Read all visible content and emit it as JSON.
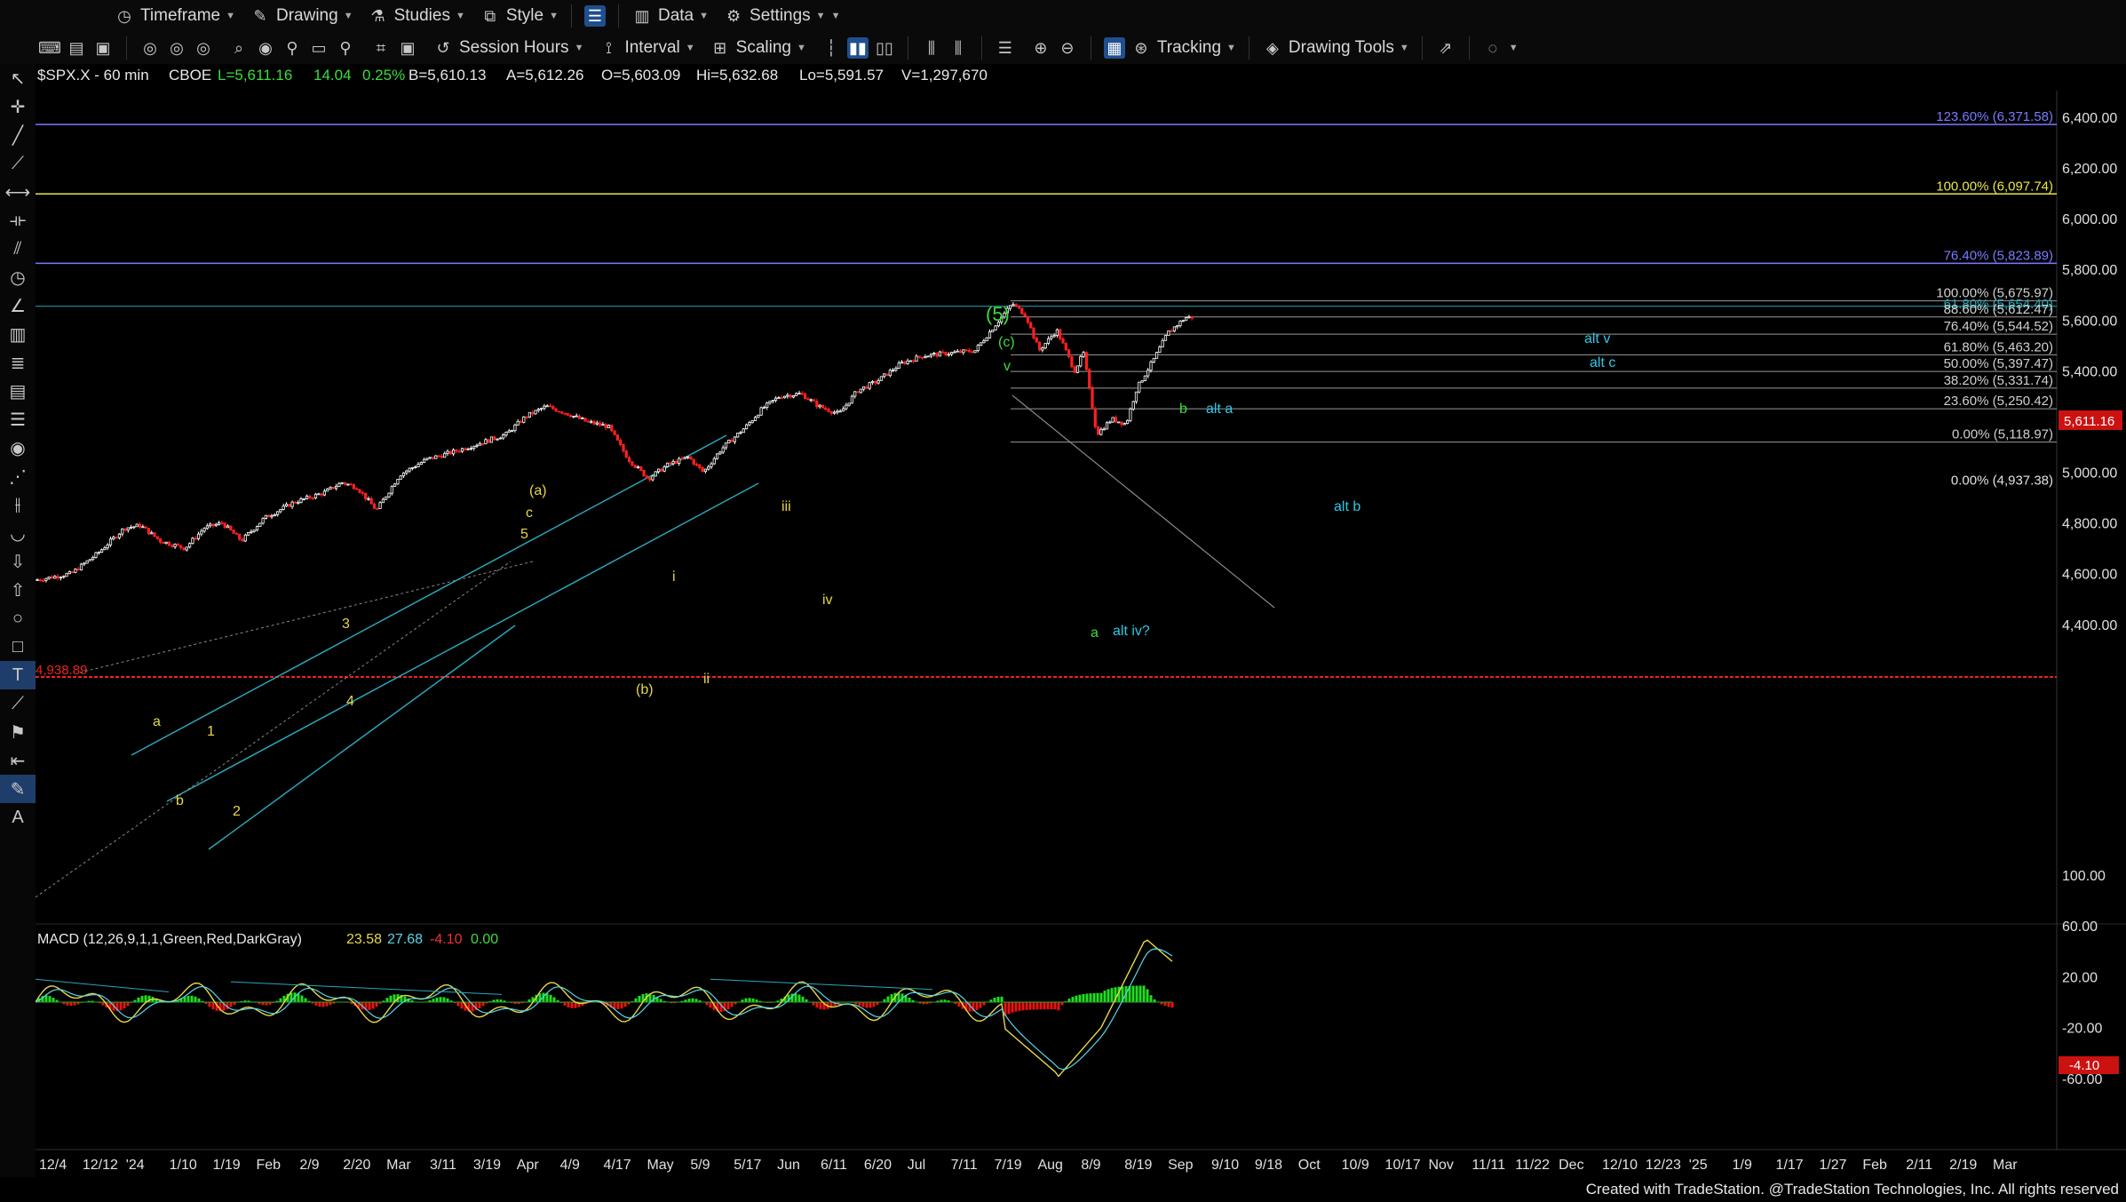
{
  "toolbar1": {
    "timeframe": "Timeframe",
    "drawing": "Drawing",
    "studies": "Studies",
    "style": "Style",
    "data": "Data",
    "settings": "Settings"
  },
  "toolbar2": {
    "session_hours": "Session Hours",
    "interval": "Interval",
    "scaling": "Scaling",
    "tracking": "Tracking",
    "drawing_tools": "Drawing Tools"
  },
  "header": {
    "symbol": "$SPX.X - 60 min",
    "exchange": "CBOE",
    "last": "L=5,611.16",
    "change": "14.04",
    "pct": "0.25%",
    "bid": "B=5,610.13",
    "ask": "A=5,612.26",
    "open": "O=5,603.09",
    "high": "Hi=5,632.68",
    "low": "Lo=5,591.57",
    "volume": "V=1,297,670"
  },
  "macd_header": {
    "name": "MACD (12,26,9,1,1,Green,Red,DarkGray)",
    "v1": "23.58",
    "v2": "27.68",
    "v3": "-4.10",
    "v4": "0.00"
  },
  "price_axis": [
    "6,400.00",
    "6,200.00",
    "6,000.00",
    "5,800.00",
    "5,600.00",
    "5,400.00",
    "5,200.00",
    "5,000.00",
    "4,800.00",
    "4,600.00",
    "4,400.00"
  ],
  "macd_axis": [
    "100.00",
    "60.00",
    "20.00",
    "-20.00",
    "-60.00"
  ],
  "macd_current": "-4.10",
  "price_current": "5,611.16",
  "left_level_label": "4,938.89",
  "x_axis": [
    "12/4",
    "12/12",
    "'24",
    "1/10",
    "1/19",
    "Feb",
    "2/9",
    "2/20",
    "Mar",
    "3/11",
    "3/19",
    "Apr",
    "4/9",
    "4/17",
    "May",
    "5/9",
    "5/17",
    "Jun",
    "6/11",
    "6/20",
    "Jul",
    "7/11",
    "7/19",
    "Aug",
    "8/9",
    "8/19",
    "Sep",
    "9/10",
    "9/18",
    "Oct",
    "10/9",
    "10/17",
    "Nov",
    "11/11",
    "11/22",
    "Dec",
    "12/10",
    "12/23",
    "'25",
    "1/9",
    "1/17",
    "1/27",
    "Feb",
    "2/11",
    "2/19",
    "Mar"
  ],
  "fib_upper": [
    {
      "label": "123.60% (6,371.58)",
      "price": 6371.58,
      "color": "#7a7aff"
    },
    {
      "label": "100.00% (6,097.74)",
      "price": 6097.74,
      "color": "#e6e64a"
    },
    {
      "label": "76.40% (5,823.89)",
      "price": 5823.89,
      "color": "#7a7aff"
    }
  ],
  "fib_retrace": [
    {
      "label": "100.00% (5,675.97)",
      "price": 5675.97
    },
    {
      "label": "61.80% (5,654.40)",
      "price": 5654.4
    },
    {
      "label": "88.60% (5,612.47)",
      "price": 5612.47
    },
    {
      "label": "76.40% (5,544.52)",
      "price": 5544.52
    },
    {
      "label": "61.80% (5,463.20)",
      "price": 5463.2
    },
    {
      "label": "50.00% (5,397.47)",
      "price": 5397.47
    },
    {
      "label": "38.20% (5,331.74)",
      "price": 5331.74
    },
    {
      "label": "23.60% (5,250.42)",
      "price": 5250.42
    },
    {
      "label": "0.00% (5,118.97)",
      "price": 5118.97
    }
  ],
  "fib_base": {
    "label": "0.00% (4,937.38)",
    "price": 4937.38
  },
  "wave_labels": {
    "w5": "(5)",
    "wc": "(c)",
    "wv": "v",
    "wa_paren": "(a)",
    "wc_small": "c",
    "w5_small": "5",
    "w3": "3",
    "w1": "1",
    "w2": "2",
    "w4": "4",
    "wa": "a",
    "wb": "b",
    "wb_paren": "(b)",
    "wi": "i",
    "wii": "ii",
    "wiii": "iii",
    "wiv": "iv",
    "a_green": "a",
    "alt_iv": "alt iv?",
    "b_green": "b",
    "alt_a": "alt a",
    "alt_b": "alt b",
    "alt_v": "alt v",
    "alt_c": "alt c"
  },
  "footer": "Created with TradeStation. @TradeStation Technologies, Inc. All rights reserved",
  "colors": {
    "up": "#ffffff",
    "down": "#ff2020",
    "macd_pos": "#22dd22",
    "macd_neg": "#ee1111",
    "channel": "#2aa6b8"
  }
}
